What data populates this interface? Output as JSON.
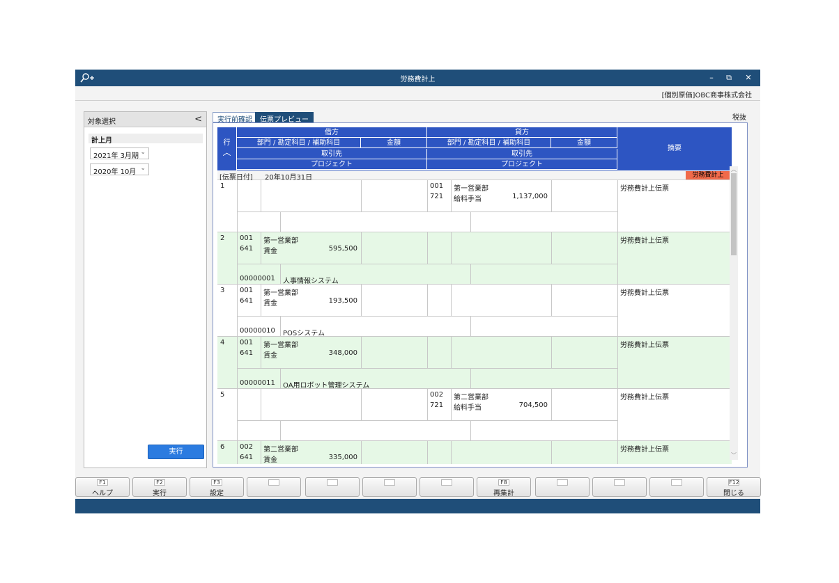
{
  "window": {
    "title": "労務費計上",
    "company": "[個別原価]OBC商事株式会社"
  },
  "left_panel": {
    "title": "対象選択",
    "collapse_glyph": "<",
    "section_label": "計上月",
    "fiscal_period": "2021年 3月期",
    "month": "2020年 10月",
    "run_label": "実行"
  },
  "tabs": [
    {
      "label": "実行前確認",
      "active": false
    },
    {
      "label": "伝票プレビュー",
      "active": true
    }
  ],
  "tax_label": "税抜",
  "grid": {
    "header": {
      "row_label": "行",
      "debit": "借方",
      "credit": "貸方",
      "dept_account": "部門 / 勘定科目 / 補助科目",
      "amount": "金額",
      "partner": "取引先",
      "project": "プロジェクト",
      "summary": "摘要"
    },
    "date_label": "[伝票日付]",
    "date_value": "20年10月31日",
    "badge": "労務費計上",
    "rows": [
      {
        "no": "1",
        "debit": {
          "dept_code": "",
          "dept_name": "",
          "acct_code": "",
          "acct_name": "",
          "amount": "",
          "project_code": "",
          "project_name": ""
        },
        "credit": {
          "dept_code": "001",
          "dept_name": "第一営業部",
          "acct_code": "721",
          "acct_name": "給料手当",
          "amount": "1,137,000"
        },
        "summary": "労務費計上伝票"
      },
      {
        "no": "2",
        "debit": {
          "dept_code": "001",
          "dept_name": "第一営業部",
          "acct_code": "641",
          "acct_name": "賃金",
          "amount": "595,500",
          "project_code": "00000001",
          "project_name": "人事情報システム"
        },
        "credit": {
          "dept_code": "",
          "dept_name": "",
          "acct_code": "",
          "acct_name": "",
          "amount": ""
        },
        "summary": "労務費計上伝票"
      },
      {
        "no": "3",
        "debit": {
          "dept_code": "001",
          "dept_name": "第一営業部",
          "acct_code": "641",
          "acct_name": "賃金",
          "amount": "193,500",
          "project_code": "00000010",
          "project_name": "POSシステム"
        },
        "credit": {
          "dept_code": "",
          "dept_name": "",
          "acct_code": "",
          "acct_name": "",
          "amount": ""
        },
        "summary": "労務費計上伝票"
      },
      {
        "no": "4",
        "debit": {
          "dept_code": "001",
          "dept_name": "第一営業部",
          "acct_code": "641",
          "acct_name": "賃金",
          "amount": "348,000",
          "project_code": "00000011",
          "project_name": "OA用ロボット管理システム"
        },
        "credit": {
          "dept_code": "",
          "dept_name": "",
          "acct_code": "",
          "acct_name": "",
          "amount": ""
        },
        "summary": "労務費計上伝票"
      },
      {
        "no": "5",
        "debit": {
          "dept_code": "",
          "dept_name": "",
          "acct_code": "",
          "acct_name": "",
          "amount": "",
          "project_code": "",
          "project_name": ""
        },
        "credit": {
          "dept_code": "002",
          "dept_name": "第二営業部",
          "acct_code": "721",
          "acct_name": "給料手当",
          "amount": "704,500"
        },
        "summary": "労務費計上伝票"
      },
      {
        "no": "6",
        "debit": {
          "dept_code": "002",
          "dept_name": "第二営業部",
          "acct_code": "641",
          "acct_name": "賃金",
          "amount": "335,000",
          "project_code": "",
          "project_name": ""
        },
        "credit": {
          "dept_code": "",
          "dept_name": "",
          "acct_code": "",
          "acct_name": "",
          "amount": ""
        },
        "summary": "労務費計上伝票"
      }
    ]
  },
  "fkeys": [
    {
      "code": "F1",
      "label": "ヘルプ"
    },
    {
      "code": "F2",
      "label": "実行"
    },
    {
      "code": "F3",
      "label": "設定"
    },
    {
      "code": "",
      "label": ""
    },
    {
      "code": "",
      "label": ""
    },
    {
      "code": "",
      "label": ""
    },
    {
      "code": "",
      "label": ""
    },
    {
      "code": "F8",
      "label": "再集計"
    },
    {
      "code": "",
      "label": ""
    },
    {
      "code": "",
      "label": ""
    },
    {
      "code": "",
      "label": ""
    },
    {
      "code": "F12",
      "label": "閉じる"
    }
  ],
  "colors": {
    "titlebar": "#1f4e79",
    "grid_header": "#2d55c2",
    "row_green": "#e6f8e6",
    "badge": "#f06a4a",
    "run_button": "#2b7be0"
  }
}
